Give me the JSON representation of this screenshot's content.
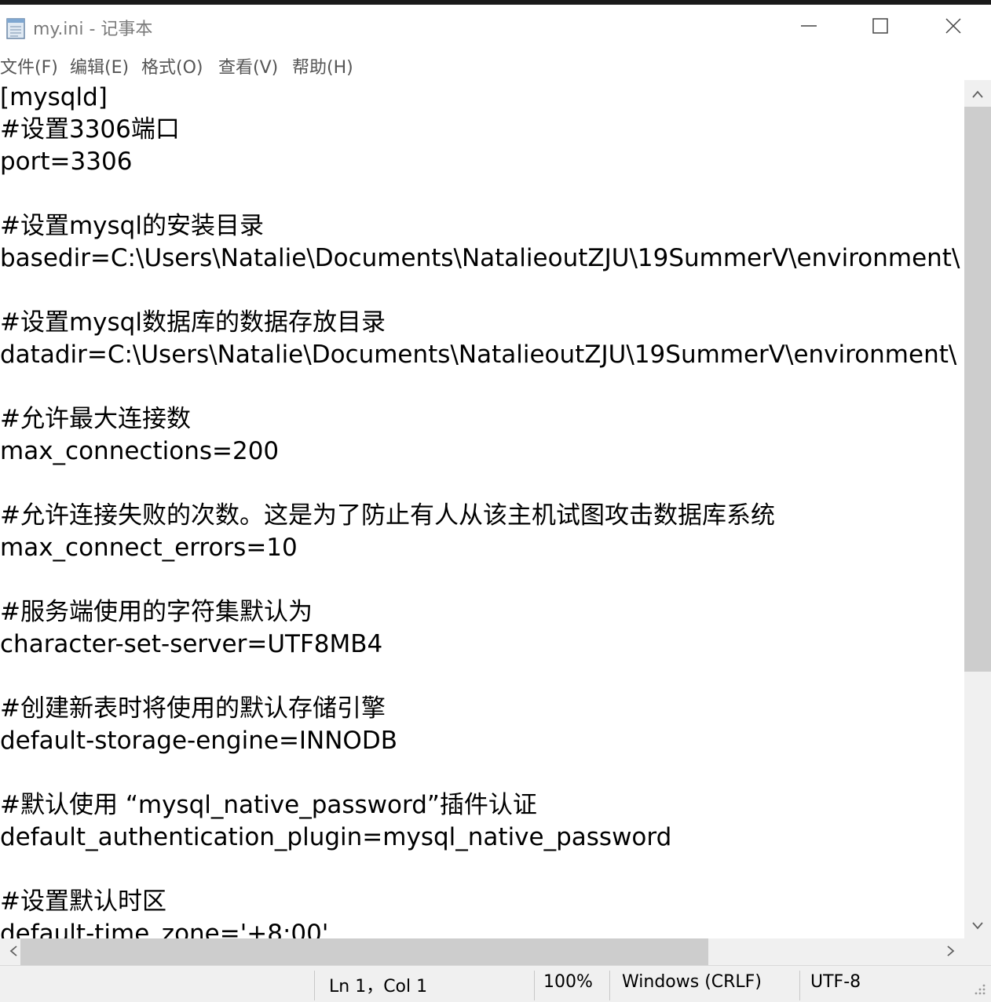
{
  "window": {
    "title": "my.ini - 记事本",
    "icon": "notepad-icon",
    "controls": [
      "minimize-icon",
      "maximize-icon",
      "close-icon"
    ]
  },
  "menu": {
    "file": "文件(F)",
    "edit": "编辑(E)",
    "format": "格式(O)",
    "view": "查看(V)",
    "help": "帮助(H)"
  },
  "editor": {
    "lines": [
      "[mysqld]",
      "#设置3306端口",
      "port=3306",
      "",
      "#设置mysql的安装目录",
      "basedir=C:\\Users\\Natalie\\Documents\\NatalieoutZJU\\19SummerV\\environment\\",
      "",
      "#设置mysql数据库的数据存放目录",
      "datadir=C:\\Users\\Natalie\\Documents\\NatalieoutZJU\\19SummerV\\environment\\",
      "",
      "#允许最大连接数",
      "max_connections=200",
      "",
      "#允许连接失败的次数。这是为了防止有人从该主机试图攻击数据库系统",
      "max_connect_errors=10",
      "",
      "#服务端使用的字符集默认为",
      "character-set-server=UTF8MB4",
      "",
      "#创建新表时将使用的默认存储引擎",
      "default-storage-engine=INNODB",
      "",
      "#默认使用 “mysql_native_password”插件认证",
      "default_authentication_plugin=mysql_native_password",
      "",
      "#设置默认时区",
      "default-time_zone='+8:00'"
    ]
  },
  "status": {
    "position": "Ln 1，Col 1",
    "zoom": "100%",
    "line_ending": "Windows (CRLF)",
    "encoding": "UTF-8"
  }
}
